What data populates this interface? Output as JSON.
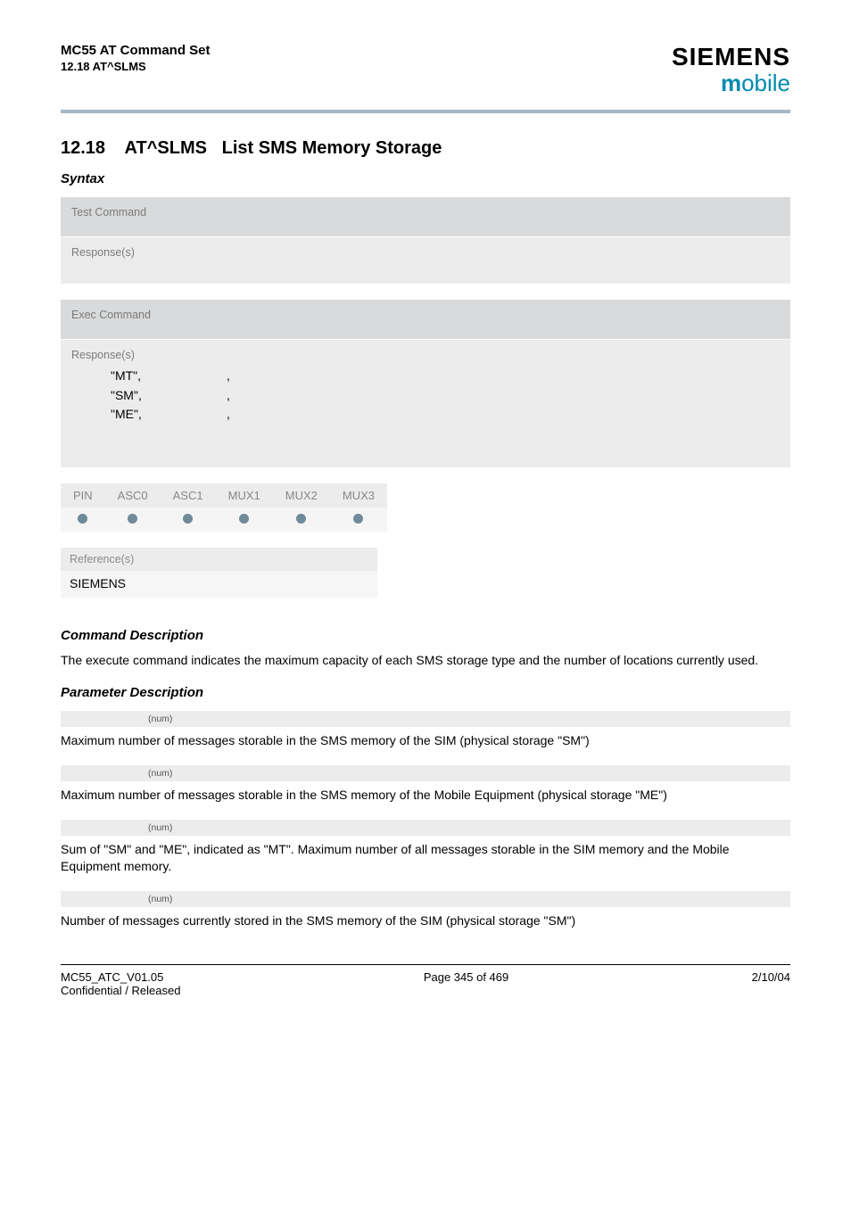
{
  "header": {
    "doc_title": "MC55 AT Command Set",
    "doc_subtitle": "12.18 AT^SLMS",
    "brand": "SIEMENS",
    "brand_sub": "obile",
    "brand_sub_prefix": "m"
  },
  "section": {
    "number": "12.18",
    "cmd": "AT^SLMS",
    "title": "List SMS Memory Storage"
  },
  "syntax_label": "Syntax",
  "blocks": {
    "test_label": "Test Command",
    "response_label": "Response(s)",
    "exec_label": "Exec Command",
    "rows": [
      {
        "mem": "\"MT\",",
        "sep": ","
      },
      {
        "mem": "\"SM\",",
        "sep": ","
      },
      {
        "mem": "\"ME\",",
        "sep": ","
      }
    ]
  },
  "pin_table": {
    "headers": [
      "PIN",
      "ASC0",
      "ASC1",
      "MUX1",
      "MUX2",
      "MUX3"
    ]
  },
  "reference": {
    "label": "Reference(s)",
    "value": "SIEMENS"
  },
  "cmd_desc": {
    "heading": "Command Description",
    "text": "The execute command indicates the maximum capacity of each SMS storage type and the number of locations currently used."
  },
  "param_desc": {
    "heading": "Parameter Description",
    "items": [
      {
        "tag": "(num)",
        "text": "Maximum number of messages storable in the SMS memory of the SIM (physical storage \"SM\")"
      },
      {
        "tag": "(num)",
        "text": "Maximum number of messages storable in the SMS memory of the Mobile Equipment (physical storage \"ME\")"
      },
      {
        "tag": "(num)",
        "text": "Sum of \"SM\" and \"ME\", indicated as \"MT\". Maximum number of all messages storable in the SIM memory and the Mobile Equipment memory."
      },
      {
        "tag": "(num)",
        "text": "Number of messages currently stored in the SMS memory of the SIM (physical storage \"SM\")"
      }
    ]
  },
  "footer": {
    "left_line1": "MC55_ATC_V01.05",
    "left_line2": "Confidential / Released",
    "center": "Page 345 of 469",
    "right": "2/10/04"
  }
}
